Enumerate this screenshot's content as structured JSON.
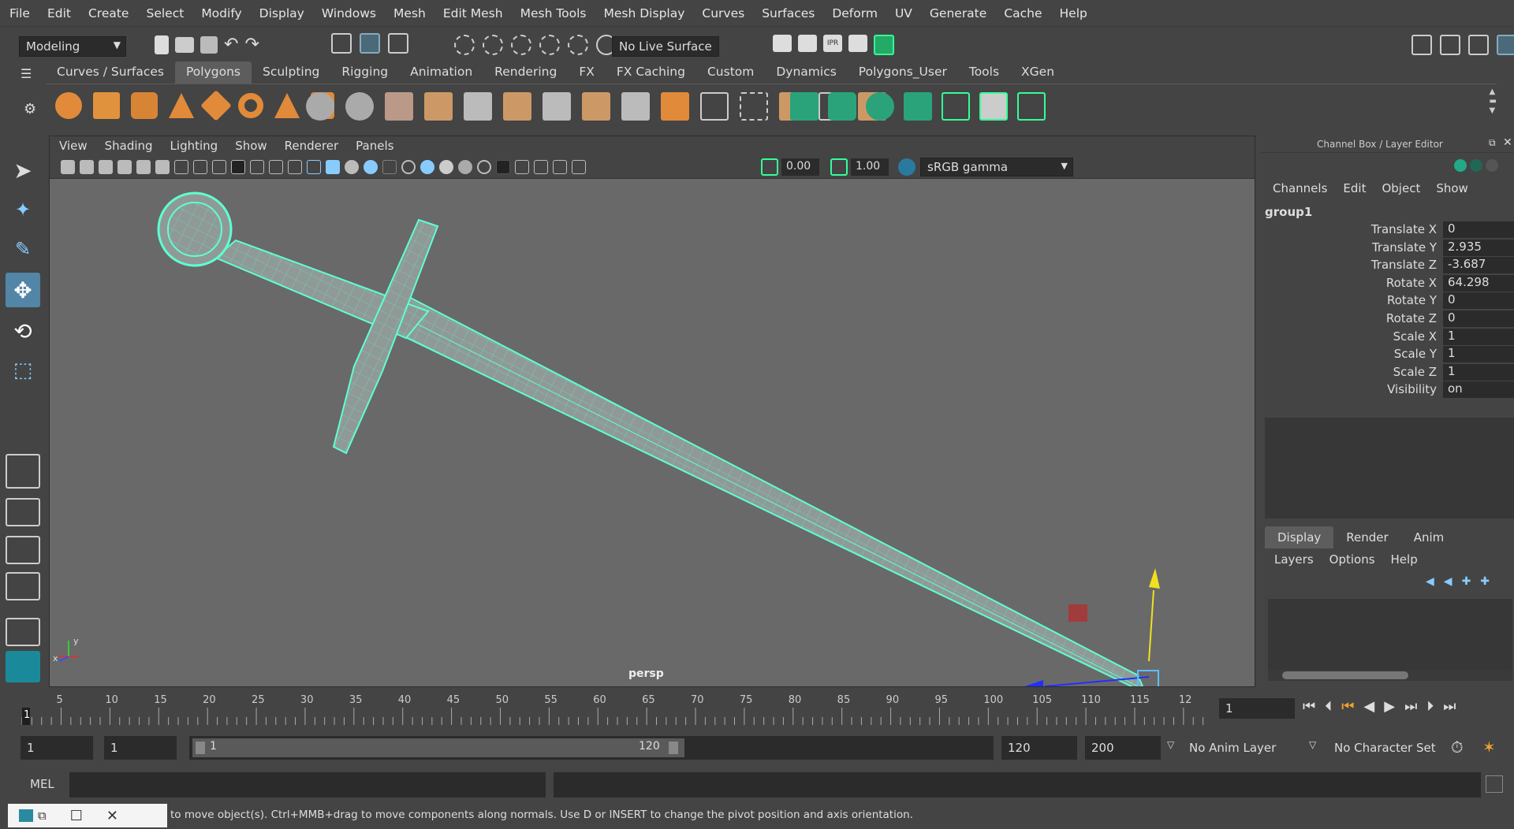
{
  "menubar": [
    "File",
    "Edit",
    "Create",
    "Select",
    "Modify",
    "Display",
    "Windows",
    "Mesh",
    "Edit Mesh",
    "Mesh Tools",
    "Mesh Display",
    "Curves",
    "Surfaces",
    "Deform",
    "UV",
    "Generate",
    "Cache",
    "Help"
  ],
  "statusline": {
    "mode": "Modeling",
    "live_surface": "No Live Surface"
  },
  "shelf_tabs": [
    "Curves / Surfaces",
    "Polygons",
    "Sculpting",
    "Rigging",
    "Animation",
    "Rendering",
    "FX",
    "FX Caching",
    "Custom",
    "Dynamics",
    "Polygons_User",
    "Tools",
    "XGen"
  ],
  "shelf_active": "Polygons",
  "viewport": {
    "menu": [
      "View",
      "Shading",
      "Lighting",
      "Show",
      "Renderer",
      "Panels"
    ],
    "exposure": "0.00",
    "gamma": "1.00",
    "color_space": "sRGB gamma",
    "camera_label": "persp",
    "axis_x": "x",
    "axis_y": "y"
  },
  "channel_box": {
    "title": "Channel Box / Layer Editor",
    "menu": [
      "Channels",
      "Edit",
      "Object",
      "Show"
    ],
    "object": "group1",
    "channels": [
      {
        "label": "Translate X",
        "value": "0"
      },
      {
        "label": "Translate Y",
        "value": "2.935"
      },
      {
        "label": "Translate Z",
        "value": "-3.687"
      },
      {
        "label": "Rotate X",
        "value": "64.298"
      },
      {
        "label": "Rotate Y",
        "value": "0"
      },
      {
        "label": "Rotate Z",
        "value": "0"
      },
      {
        "label": "Scale X",
        "value": "1"
      },
      {
        "label": "Scale Y",
        "value": "1"
      },
      {
        "label": "Scale Z",
        "value": "1"
      },
      {
        "label": "Visibility",
        "value": "on"
      }
    ],
    "layer_tabs": [
      "Display",
      "Render",
      "Anim"
    ],
    "layer_menu": [
      "Layers",
      "Options",
      "Help"
    ]
  },
  "timeline": {
    "ticks": [
      "5",
      "10",
      "15",
      "20",
      "25",
      "30",
      "35",
      "40",
      "45",
      "50",
      "55",
      "60",
      "65",
      "70",
      "75",
      "80",
      "85",
      "90",
      "95",
      "100",
      "105",
      "110",
      "115",
      "12"
    ],
    "start_marker": "1",
    "current_frame": "1"
  },
  "range": {
    "start": "1",
    "playback_start": "1",
    "slider_start": "1",
    "slider_end": "120",
    "playback_end": "120",
    "end": "200",
    "anim_layer": "No Anim Layer",
    "character_set": "No Character Set"
  },
  "command": {
    "lang": "MEL"
  },
  "help_text": "to move object(s). Ctrl+MMB+drag to move components along normals. Use D or INSERT to change the pivot position and axis orientation.",
  "colors": {
    "accent": "#5fffd2",
    "bg": "#444444",
    "viewport": "#696969",
    "field": "#2b2b2b"
  }
}
